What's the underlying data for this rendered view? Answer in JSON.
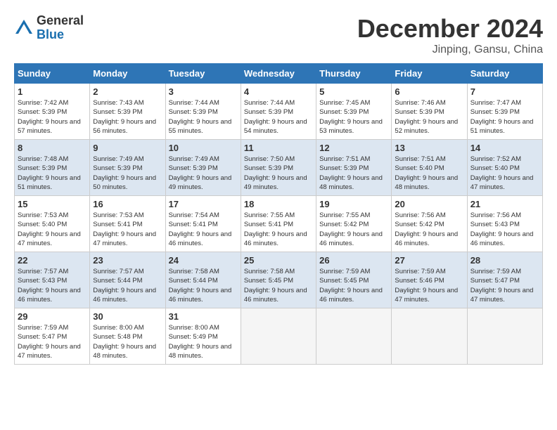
{
  "header": {
    "logo_general": "General",
    "logo_blue": "Blue",
    "month_title": "December 2024",
    "location": "Jinping, Gansu, China"
  },
  "days_of_week": [
    "Sunday",
    "Monday",
    "Tuesday",
    "Wednesday",
    "Thursday",
    "Friday",
    "Saturday"
  ],
  "weeks": [
    [
      {
        "day": "1",
        "sunrise": "7:42 AM",
        "sunset": "5:39 PM",
        "daylight": "9 hours and 57 minutes."
      },
      {
        "day": "2",
        "sunrise": "7:43 AM",
        "sunset": "5:39 PM",
        "daylight": "9 hours and 56 minutes."
      },
      {
        "day": "3",
        "sunrise": "7:44 AM",
        "sunset": "5:39 PM",
        "daylight": "9 hours and 55 minutes."
      },
      {
        "day": "4",
        "sunrise": "7:44 AM",
        "sunset": "5:39 PM",
        "daylight": "9 hours and 54 minutes."
      },
      {
        "day": "5",
        "sunrise": "7:45 AM",
        "sunset": "5:39 PM",
        "daylight": "9 hours and 53 minutes."
      },
      {
        "day": "6",
        "sunrise": "7:46 AM",
        "sunset": "5:39 PM",
        "daylight": "9 hours and 52 minutes."
      },
      {
        "day": "7",
        "sunrise": "7:47 AM",
        "sunset": "5:39 PM",
        "daylight": "9 hours and 51 minutes."
      }
    ],
    [
      {
        "day": "8",
        "sunrise": "7:48 AM",
        "sunset": "5:39 PM",
        "daylight": "9 hours and 51 minutes."
      },
      {
        "day": "9",
        "sunrise": "7:49 AM",
        "sunset": "5:39 PM",
        "daylight": "9 hours and 50 minutes."
      },
      {
        "day": "10",
        "sunrise": "7:49 AM",
        "sunset": "5:39 PM",
        "daylight": "9 hours and 49 minutes."
      },
      {
        "day": "11",
        "sunrise": "7:50 AM",
        "sunset": "5:39 PM",
        "daylight": "9 hours and 49 minutes."
      },
      {
        "day": "12",
        "sunrise": "7:51 AM",
        "sunset": "5:39 PM",
        "daylight": "9 hours and 48 minutes."
      },
      {
        "day": "13",
        "sunrise": "7:51 AM",
        "sunset": "5:40 PM",
        "daylight": "9 hours and 48 minutes."
      },
      {
        "day": "14",
        "sunrise": "7:52 AM",
        "sunset": "5:40 PM",
        "daylight": "9 hours and 47 minutes."
      }
    ],
    [
      {
        "day": "15",
        "sunrise": "7:53 AM",
        "sunset": "5:40 PM",
        "daylight": "9 hours and 47 minutes."
      },
      {
        "day": "16",
        "sunrise": "7:53 AM",
        "sunset": "5:41 PM",
        "daylight": "9 hours and 47 minutes."
      },
      {
        "day": "17",
        "sunrise": "7:54 AM",
        "sunset": "5:41 PM",
        "daylight": "9 hours and 46 minutes."
      },
      {
        "day": "18",
        "sunrise": "7:55 AM",
        "sunset": "5:41 PM",
        "daylight": "9 hours and 46 minutes."
      },
      {
        "day": "19",
        "sunrise": "7:55 AM",
        "sunset": "5:42 PM",
        "daylight": "9 hours and 46 minutes."
      },
      {
        "day": "20",
        "sunrise": "7:56 AM",
        "sunset": "5:42 PM",
        "daylight": "9 hours and 46 minutes."
      },
      {
        "day": "21",
        "sunrise": "7:56 AM",
        "sunset": "5:43 PM",
        "daylight": "9 hours and 46 minutes."
      }
    ],
    [
      {
        "day": "22",
        "sunrise": "7:57 AM",
        "sunset": "5:43 PM",
        "daylight": "9 hours and 46 minutes."
      },
      {
        "day": "23",
        "sunrise": "7:57 AM",
        "sunset": "5:44 PM",
        "daylight": "9 hours and 46 minutes."
      },
      {
        "day": "24",
        "sunrise": "7:58 AM",
        "sunset": "5:44 PM",
        "daylight": "9 hours and 46 minutes."
      },
      {
        "day": "25",
        "sunrise": "7:58 AM",
        "sunset": "5:45 PM",
        "daylight": "9 hours and 46 minutes."
      },
      {
        "day": "26",
        "sunrise": "7:59 AM",
        "sunset": "5:45 PM",
        "daylight": "9 hours and 46 minutes."
      },
      {
        "day": "27",
        "sunrise": "7:59 AM",
        "sunset": "5:46 PM",
        "daylight": "9 hours and 47 minutes."
      },
      {
        "day": "28",
        "sunrise": "7:59 AM",
        "sunset": "5:47 PM",
        "daylight": "9 hours and 47 minutes."
      }
    ],
    [
      {
        "day": "29",
        "sunrise": "7:59 AM",
        "sunset": "5:47 PM",
        "daylight": "9 hours and 47 minutes."
      },
      {
        "day": "30",
        "sunrise": "8:00 AM",
        "sunset": "5:48 PM",
        "daylight": "9 hours and 48 minutes."
      },
      {
        "day": "31",
        "sunrise": "8:00 AM",
        "sunset": "5:49 PM",
        "daylight": "9 hours and 48 minutes."
      },
      null,
      null,
      null,
      null
    ]
  ]
}
